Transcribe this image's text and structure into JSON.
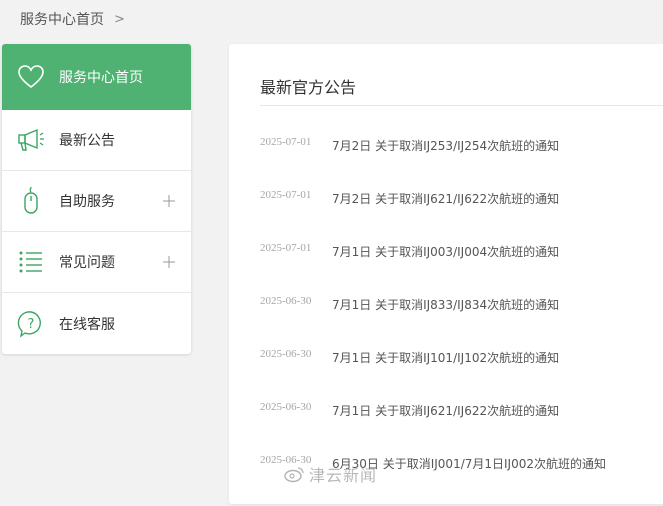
{
  "breadcrumb": {
    "home": "服务中心首页",
    "separator": ">"
  },
  "sidebar": {
    "items": [
      {
        "label": "服务中心首页",
        "icon": "heart-icon",
        "active": true,
        "expandable": false
      },
      {
        "label": "最新公告",
        "icon": "megaphone-icon",
        "active": false,
        "expandable": false
      },
      {
        "label": "自助服务",
        "icon": "mouse-icon",
        "active": false,
        "expandable": true
      },
      {
        "label": "常见问题",
        "icon": "list-icon",
        "active": false,
        "expandable": true
      },
      {
        "label": "在线客服",
        "icon": "question-chat-icon",
        "active": false,
        "expandable": false
      }
    ]
  },
  "main": {
    "title": "最新官方公告",
    "notices": [
      {
        "date": "2025-07-01",
        "title": "7月2日 关于取消IJ253/IJ254次航班的通知"
      },
      {
        "date": "2025-07-01",
        "title": "7月2日 关于取消IJ621/IJ622次航班的通知"
      },
      {
        "date": "2025-07-01",
        "title": "7月1日 关于取消IJ003/IJ004次航班的通知"
      },
      {
        "date": "2025-06-30",
        "title": "7月1日 关于取消IJ833/IJ834次航班的通知"
      },
      {
        "date": "2025-06-30",
        "title": "7月1日 关于取消IJ101/IJ102次航班的通知"
      },
      {
        "date": "2025-06-30",
        "title": "7月1日 关于取消IJ621/IJ622次航班的通知"
      },
      {
        "date": "2025-06-30",
        "title": "6月30日 关于取消IJ001/7月1日IJ002次航班的通知"
      }
    ]
  },
  "watermark": {
    "text": "津云新闻"
  },
  "colors": {
    "accent": "#4fb272",
    "icon_green": "#3aa564",
    "background": "#f2f2f2"
  }
}
